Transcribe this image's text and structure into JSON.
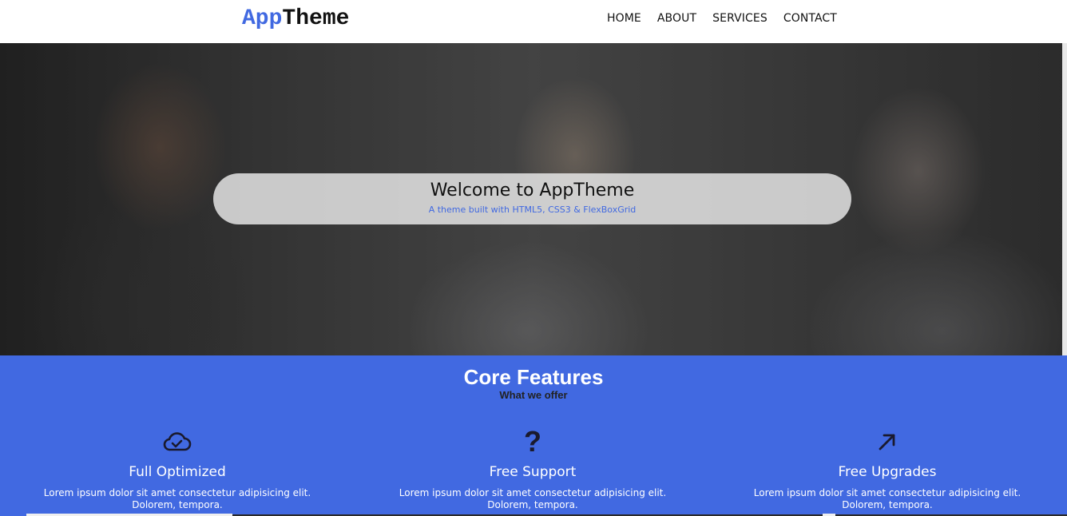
{
  "header": {
    "logo_part1": "App",
    "logo_part2": "Theme",
    "nav": [
      {
        "label": "HOME"
      },
      {
        "label": "ABOUT"
      },
      {
        "label": "SERVICES"
      },
      {
        "label": "CONTACT"
      }
    ]
  },
  "hero": {
    "title": "Welcome to AppTheme",
    "subtitle": "A theme built with HTML5, CSS3 & FlexBoxGrid"
  },
  "features": {
    "title": "Core Features",
    "subtitle": "What we offer",
    "items": [
      {
        "icon": "cloud-check-icon",
        "title": "Full Optimized",
        "text": "Lorem ipsum dolor sit amet consectetur adipisicing elit. Dolorem, tempora."
      },
      {
        "icon": "question-icon",
        "title": "Free Support",
        "text": "Lorem ipsum dolor sit amet consectetur adipisicing elit. Dolorem, tempora."
      },
      {
        "icon": "arrow-up-right-icon",
        "title": "Free Upgrades",
        "text": "Lorem ipsum dolor sit amet consectetur adipisicing elit. Dolorem, tempora."
      }
    ]
  },
  "colors": {
    "accent": "#4169e1",
    "text_dark": "#111111",
    "white": "#ffffff"
  }
}
